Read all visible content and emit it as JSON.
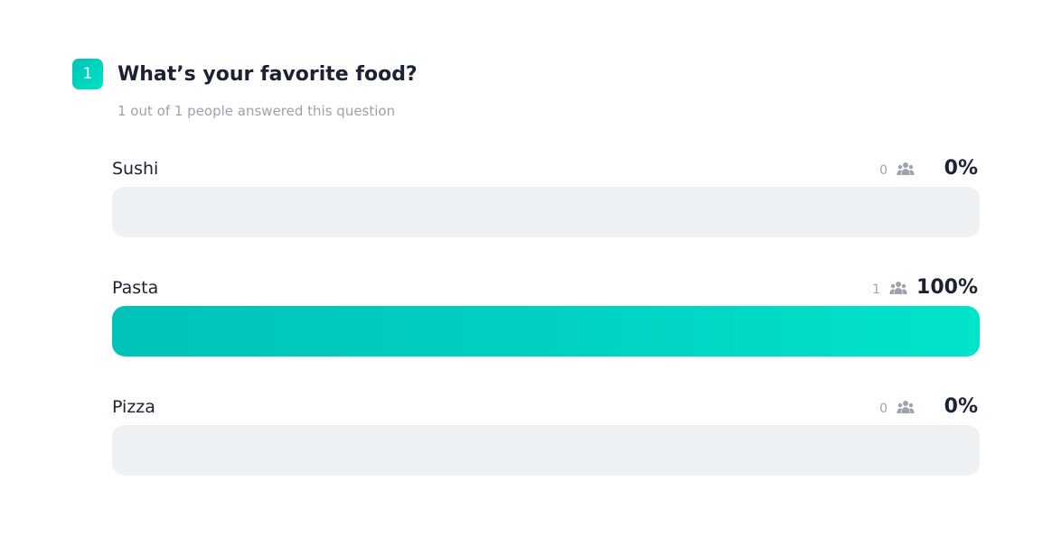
{
  "question": {
    "number": "1",
    "title": "What’s your favorite food?",
    "subtitle": "1 out of 1 people answered this question"
  },
  "colors": {
    "accent": "#00d2c1",
    "track": "#eef1f4",
    "text": "#1b2233",
    "muted": "#9aa3ae"
  },
  "options": [
    {
      "label": "Sushi",
      "count": "0",
      "percent": "0%",
      "fraction": 0,
      "icon": "people-icon"
    },
    {
      "label": "Pasta",
      "count": "1",
      "percent": "100%",
      "fraction": 1,
      "icon": "people-icon"
    },
    {
      "label": "Pizza",
      "count": "0",
      "percent": "0%",
      "fraction": 0,
      "icon": "people-icon"
    }
  ]
}
